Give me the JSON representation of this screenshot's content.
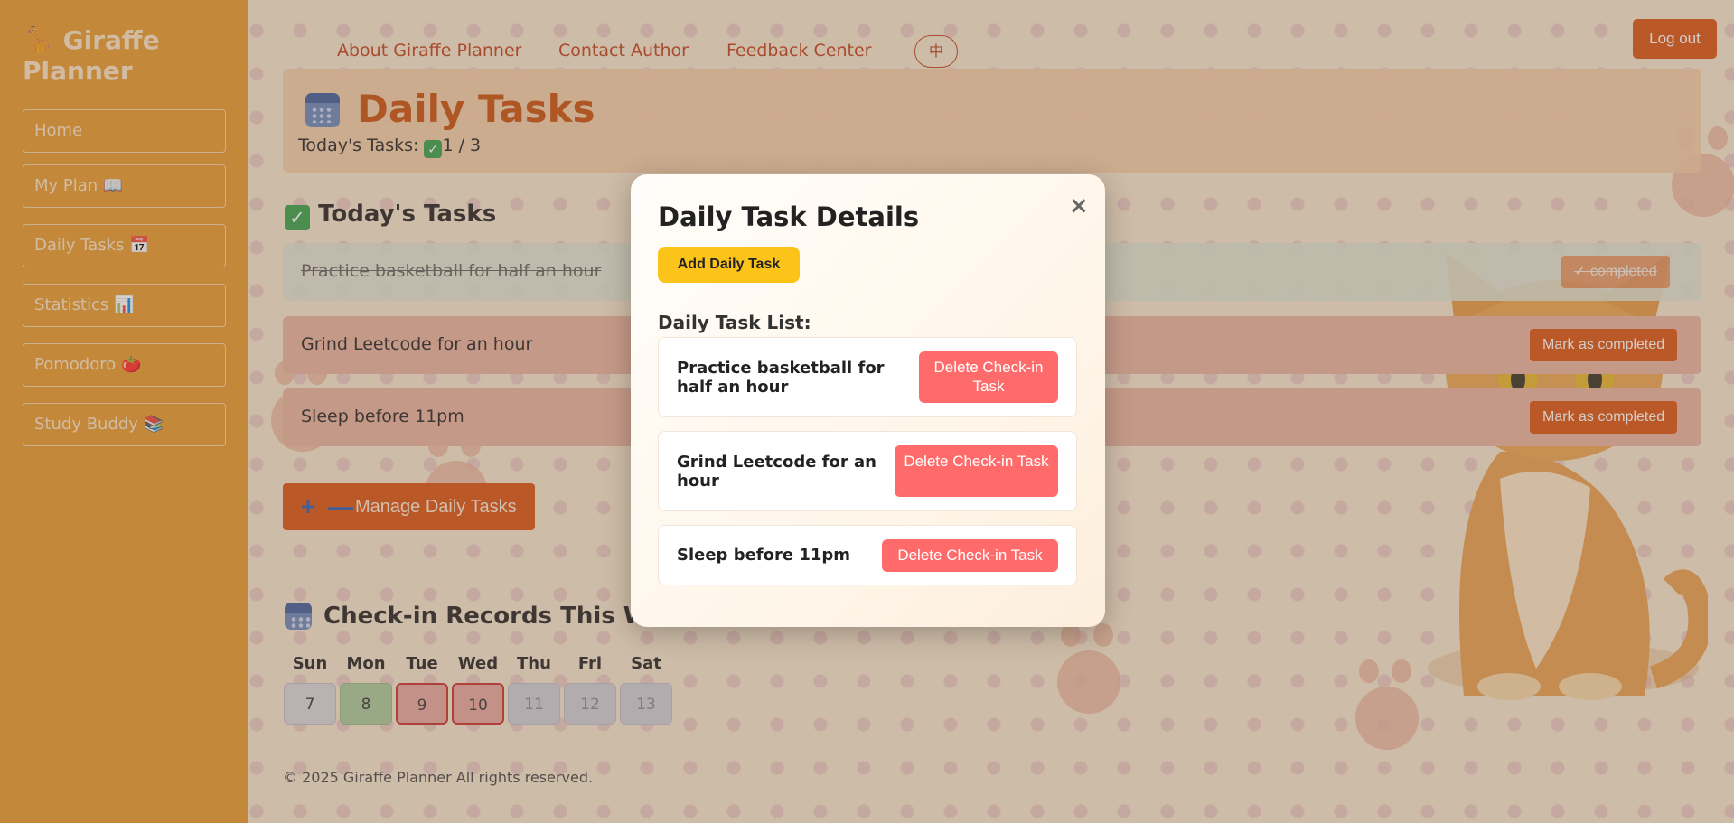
{
  "app": {
    "brand": "🦒 Giraffe Planner"
  },
  "sidebar": {
    "items": [
      {
        "label": "Home"
      },
      {
        "label": "My Plan 📖"
      },
      {
        "label": "Daily Tasks 📅"
      },
      {
        "label": "Statistics 📊"
      },
      {
        "label": "Pomodoro 🍅"
      },
      {
        "label": "Study Buddy 📚"
      }
    ]
  },
  "topnav": {
    "links": [
      "About Giraffe Planner",
      "Contact Author",
      "Feedback Center"
    ],
    "lang": "中",
    "logout": "Log out"
  },
  "header": {
    "title": "Daily Tasks",
    "counter_label": "Today's Tasks:",
    "counter_check": "✓",
    "counter_value": "1 / 3"
  },
  "today": {
    "title": "Today's Tasks",
    "tasks": [
      {
        "text": "Practice basketball for half an hour",
        "status": "✓ completed"
      },
      {
        "text": "Grind Leetcode for an hour",
        "status": "Mark as completed"
      },
      {
        "text": "Sleep before 11pm",
        "status": "Mark as completed"
      }
    ],
    "manage": "Manage Daily Tasks",
    "manage_plus": "+",
    "manage_minus": "—"
  },
  "records": {
    "title": "Check-in Records This We",
    "days": [
      {
        "label": "Sun",
        "date": "7",
        "state": "none"
      },
      {
        "label": "Mon",
        "date": "8",
        "state": "done"
      },
      {
        "label": "Tue",
        "date": "9",
        "state": "missed"
      },
      {
        "label": "Wed",
        "date": "10",
        "state": "missed"
      },
      {
        "label": "Thu",
        "date": "11",
        "state": "future"
      },
      {
        "label": "Fri",
        "date": "12",
        "state": "future"
      },
      {
        "label": "Sat",
        "date": "13",
        "state": "future"
      }
    ]
  },
  "footer": "© 2025 Giraffe Planner All rights reserved.",
  "modal": {
    "title": "Daily Task Details",
    "close": "×",
    "add_button": "Add Daily Task",
    "list_label": "Daily Task List:",
    "items": [
      {
        "text": "Practice basketball for half an hour",
        "delete": "Delete Check-in Task"
      },
      {
        "text": "Grind Leetcode for an hour",
        "delete": "Delete Check-in Task"
      },
      {
        "text": "Sleep before 11pm",
        "delete": "Delete Check-in Task"
      }
    ]
  },
  "colors": {
    "accent": "#d9530f",
    "sidebar": "#e69a2c",
    "danger": "#ff6b6b",
    "add": "#fcc419",
    "done": "#35a04b"
  }
}
